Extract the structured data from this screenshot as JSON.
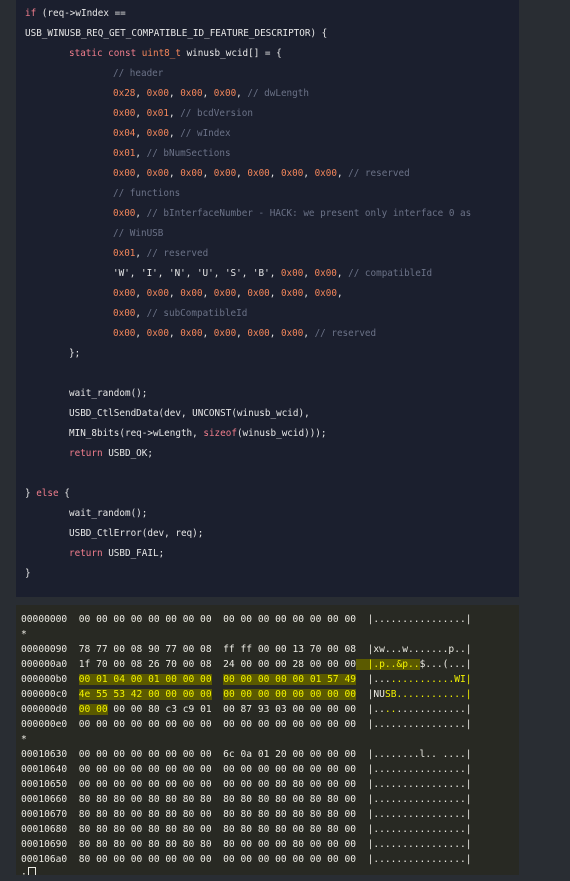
{
  "code_panel": {
    "lines": [
      {
        "indent": 0,
        "tokens": [
          {
            "t": "if",
            "c": "kw"
          },
          {
            "t": " (req->wIndex ==",
            "c": "pl"
          }
        ]
      },
      {
        "indent": 0,
        "tokens": [
          {
            "t": "USB_WINUSB_REQ_GET_COMPATIBLE_ID_FEATURE_DESCRIPTOR) {",
            "c": "pl"
          }
        ]
      },
      {
        "indent": 1,
        "tokens": [
          {
            "t": "static const",
            "c": "kw"
          },
          {
            "t": " ",
            "c": "pl"
          },
          {
            "t": "uint8_t",
            "c": "num"
          },
          {
            "t": " winusb_wcid[] = {",
            "c": "pl"
          }
        ]
      },
      {
        "indent": 2,
        "tokens": [
          {
            "t": "// header",
            "c": "cm"
          }
        ]
      },
      {
        "indent": 2,
        "tokens": [
          {
            "t": "0x28",
            "c": "num"
          },
          {
            "t": ", ",
            "c": "pl"
          },
          {
            "t": "0x00",
            "c": "num"
          },
          {
            "t": ", ",
            "c": "pl"
          },
          {
            "t": "0x00",
            "c": "num"
          },
          {
            "t": ", ",
            "c": "pl"
          },
          {
            "t": "0x00",
            "c": "num"
          },
          {
            "t": ", ",
            "c": "pl"
          },
          {
            "t": "// dwLength",
            "c": "cm"
          }
        ]
      },
      {
        "indent": 2,
        "tokens": [
          {
            "t": "0x00",
            "c": "num"
          },
          {
            "t": ", ",
            "c": "pl"
          },
          {
            "t": "0x01",
            "c": "num"
          },
          {
            "t": ", ",
            "c": "pl"
          },
          {
            "t": "// bcdVersion",
            "c": "cm"
          }
        ]
      },
      {
        "indent": 2,
        "tokens": [
          {
            "t": "0x04",
            "c": "num"
          },
          {
            "t": ", ",
            "c": "pl"
          },
          {
            "t": "0x00",
            "c": "num"
          },
          {
            "t": ", ",
            "c": "pl"
          },
          {
            "t": "// wIndex",
            "c": "cm"
          }
        ]
      },
      {
        "indent": 2,
        "tokens": [
          {
            "t": "0x01",
            "c": "num"
          },
          {
            "t": ", ",
            "c": "pl"
          },
          {
            "t": "// bNumSections",
            "c": "cm"
          }
        ]
      },
      {
        "indent": 2,
        "tokens": [
          {
            "t": "0x00",
            "c": "num"
          },
          {
            "t": ", ",
            "c": "pl"
          },
          {
            "t": "0x00",
            "c": "num"
          },
          {
            "t": ", ",
            "c": "pl"
          },
          {
            "t": "0x00",
            "c": "num"
          },
          {
            "t": ", ",
            "c": "pl"
          },
          {
            "t": "0x00",
            "c": "num"
          },
          {
            "t": ", ",
            "c": "pl"
          },
          {
            "t": "0x00",
            "c": "num"
          },
          {
            "t": ", ",
            "c": "pl"
          },
          {
            "t": "0x00",
            "c": "num"
          },
          {
            "t": ", ",
            "c": "pl"
          },
          {
            "t": "0x00",
            "c": "num"
          },
          {
            "t": ", ",
            "c": "pl"
          },
          {
            "t": "// reserved",
            "c": "cm"
          }
        ]
      },
      {
        "indent": 2,
        "tokens": [
          {
            "t": "// functions",
            "c": "cm"
          }
        ]
      },
      {
        "indent": 2,
        "tokens": [
          {
            "t": "0x00",
            "c": "num"
          },
          {
            "t": ", ",
            "c": "pl"
          },
          {
            "t": "// bInterfaceNumber - HACK: we present only interface 0 as",
            "c": "cm"
          }
        ]
      },
      {
        "indent": 2,
        "tokens": [
          {
            "t": "// WinUSB",
            "c": "cm"
          }
        ]
      },
      {
        "indent": 2,
        "tokens": [
          {
            "t": "0x01",
            "c": "num"
          },
          {
            "t": ", ",
            "c": "pl"
          },
          {
            "t": "// reserved",
            "c": "cm"
          }
        ]
      },
      {
        "indent": 2,
        "tokens": [
          {
            "t": "'W', 'I', 'N', 'U', 'S', 'B', ",
            "c": "pl"
          },
          {
            "t": "0x00",
            "c": "num"
          },
          {
            "t": ", ",
            "c": "pl"
          },
          {
            "t": "0x00",
            "c": "num"
          },
          {
            "t": ", ",
            "c": "pl"
          },
          {
            "t": "// compatibleId",
            "c": "cm"
          }
        ]
      },
      {
        "indent": 2,
        "tokens": [
          {
            "t": "0x00",
            "c": "num"
          },
          {
            "t": ", ",
            "c": "pl"
          },
          {
            "t": "0x00",
            "c": "num"
          },
          {
            "t": ", ",
            "c": "pl"
          },
          {
            "t": "0x00",
            "c": "num"
          },
          {
            "t": ", ",
            "c": "pl"
          },
          {
            "t": "0x00",
            "c": "num"
          },
          {
            "t": ", ",
            "c": "pl"
          },
          {
            "t": "0x00",
            "c": "num"
          },
          {
            "t": ", ",
            "c": "pl"
          },
          {
            "t": "0x00",
            "c": "num"
          },
          {
            "t": ", ",
            "c": "pl"
          },
          {
            "t": "0x00",
            "c": "num"
          },
          {
            "t": ",",
            "c": "pl"
          }
        ]
      },
      {
        "indent": 2,
        "tokens": [
          {
            "t": "0x00",
            "c": "num"
          },
          {
            "t": ", ",
            "c": "pl"
          },
          {
            "t": "// subCompatibleId",
            "c": "cm"
          }
        ]
      },
      {
        "indent": 2,
        "tokens": [
          {
            "t": "0x00",
            "c": "num"
          },
          {
            "t": ", ",
            "c": "pl"
          },
          {
            "t": "0x00",
            "c": "num"
          },
          {
            "t": ", ",
            "c": "pl"
          },
          {
            "t": "0x00",
            "c": "num"
          },
          {
            "t": ", ",
            "c": "pl"
          },
          {
            "t": "0x00",
            "c": "num"
          },
          {
            "t": ", ",
            "c": "pl"
          },
          {
            "t": "0x00",
            "c": "num"
          },
          {
            "t": ", ",
            "c": "pl"
          },
          {
            "t": "0x00",
            "c": "num"
          },
          {
            "t": ", ",
            "c": "pl"
          },
          {
            "t": "// reserved",
            "c": "cm"
          }
        ]
      },
      {
        "indent": 1,
        "tokens": [
          {
            "t": "};",
            "c": "pl"
          }
        ]
      },
      {
        "indent": 0,
        "tokens": []
      },
      {
        "indent": 1,
        "tokens": [
          {
            "t": "wait_random();",
            "c": "pl"
          }
        ]
      },
      {
        "indent": 1,
        "tokens": [
          {
            "t": "USBD_CtlSendData(dev, UNCONST(winusb_wcid),",
            "c": "pl"
          }
        ]
      },
      {
        "indent": 1,
        "tokens": [
          {
            "t": "MIN_8bits(req->wLength, ",
            "c": "pl"
          },
          {
            "t": "sizeof",
            "c": "kw"
          },
          {
            "t": "(winusb_wcid)));",
            "c": "pl"
          }
        ]
      },
      {
        "indent": 1,
        "tokens": [
          {
            "t": "return",
            "c": "kw"
          },
          {
            "t": " USBD_OK;",
            "c": "pl"
          }
        ]
      },
      {
        "indent": 0,
        "tokens": []
      },
      {
        "indent": 0,
        "tokens": [
          {
            "t": "} ",
            "c": "pl"
          },
          {
            "t": "else",
            "c": "kw"
          },
          {
            "t": " {",
            "c": "pl"
          }
        ]
      },
      {
        "indent": 1,
        "tokens": [
          {
            "t": "wait_random();",
            "c": "pl"
          }
        ]
      },
      {
        "indent": 1,
        "tokens": [
          {
            "t": "USBD_CtlError(dev, req);",
            "c": "pl"
          }
        ]
      },
      {
        "indent": 1,
        "tokens": [
          {
            "t": "return",
            "c": "kw"
          },
          {
            "t": " USBD_FAIL;",
            "c": "pl"
          }
        ]
      },
      {
        "indent": 0,
        "tokens": [
          {
            "t": "}",
            "c": "pl"
          }
        ]
      }
    ]
  },
  "hex_panel": {
    "lines": [
      {
        "t": "00000000  00 00 00 00 00 00 00 00  00 00 00 00 00 00 00 00  |................|",
        "hl": []
      },
      {
        "t": "*",
        "hl": []
      },
      {
        "t": "00000090  78 77 00 08 90 77 00 08  ff ff 00 00 13 70 00 08  |xw...w.......p..|",
        "hl": []
      },
      {
        "t": "000000a0  1f 70 00 08 26 70 00 08  24 00 00 00 28 00 00 00  |.p..&p..$...(...|",
        "hl": [
          [
            58,
            69,
            "hl"
          ],
          [
            90,
            94,
            "yt"
          ]
        ]
      },
      {
        "t": "000000b0  00 01 04 00 01 00 00 00  00 00 00 00 00 01 57 49  |..............WI|",
        "hl": [
          [
            10,
            33,
            "hl"
          ],
          [
            35,
            58,
            "hl"
          ],
          [
            64,
            79,
            "yt"
          ]
        ]
      },
      {
        "t": "000000c0  4e 55 53 42 00 00 00 00  00 00 00 00 00 00 00 00  |NUSB............|",
        "hl": [
          [
            10,
            33,
            "hl"
          ],
          [
            35,
            58,
            "hl"
          ],
          [
            63,
            79,
            "yt"
          ]
        ]
      },
      {
        "t": "000000d0  00 00 00 00 80 c3 c9 01  00 87 93 03 00 00 00 00  |................|",
        "hl": [
          [
            10,
            15,
            "hl"
          ],
          [
            63,
            65,
            "yt"
          ]
        ]
      },
      {
        "t": "000000e0  00 00 00 00 00 00 00 00  00 00 00 00 00 00 00 00  |................|",
        "hl": []
      },
      {
        "t": "*",
        "hl": []
      },
      {
        "t": "00010630  00 00 00 00 00 00 00 00  6c 0a 01 20 00 00 00 00  |........l.. ....|",
        "hl": []
      },
      {
        "t": "00010640  00 00 00 00 00 00 00 00  00 00 00 00 00 00 00 00  |................|",
        "hl": []
      },
      {
        "t": "00010650  00 00 00 00 00 00 00 00  00 00 00 80 80 00 00 00  |................|",
        "hl": []
      },
      {
        "t": "00010660  80 80 80 00 80 80 80 80  80 80 80 80 00 80 80 00  |................|",
        "hl": []
      },
      {
        "t": "00010670  80 80 80 00 80 80 80 00  80 80 80 80 80 80 80 00  |................|",
        "hl": []
      },
      {
        "t": "00010680  80 80 80 00 80 80 80 00  80 80 80 80 00 80 80 00  |................|",
        "hl": []
      },
      {
        "t": "00010690  80 80 80 00 80 80 80 80  80 00 00 00 80 00 00 00  |................|",
        "hl": []
      },
      {
        "t": "000106a0  80 00 00 00 00 00 00 00  00 00 00 00 00 00 00 00  |................|",
        "hl": []
      }
    ],
    "prompt": ":"
  }
}
